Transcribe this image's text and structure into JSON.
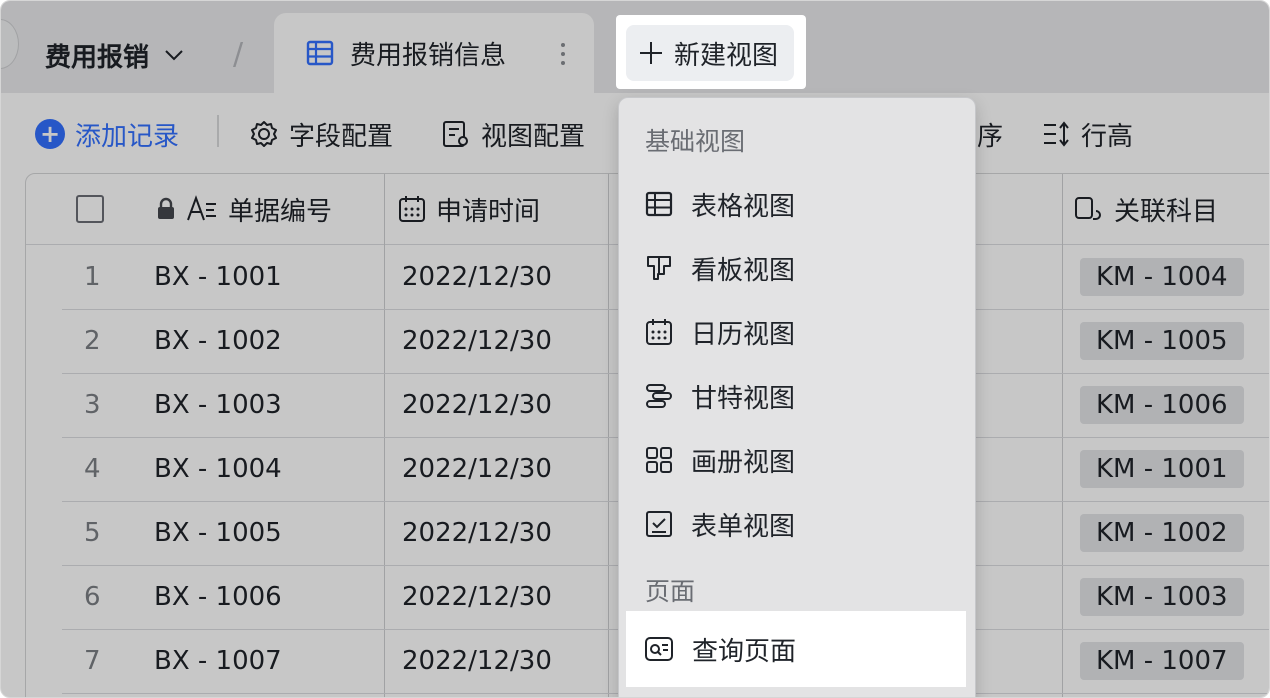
{
  "tabs": {
    "base_name": "费用报销",
    "separator": "/",
    "active_tab": "费用报销信息",
    "new_view": "新建视图"
  },
  "toolbar": {
    "add_record": "添加记录",
    "field_config": "字段配置",
    "view_config": "视图配置",
    "sort_partial": "序",
    "row_height": "行高"
  },
  "table": {
    "columns": [
      "单据编号",
      "申请时间",
      "关联科目"
    ],
    "rows": [
      {
        "n": "1",
        "id": "BX - 1001",
        "date": "2022/12/30",
        "subject": "KM - 1004"
      },
      {
        "n": "2",
        "id": "BX - 1002",
        "date": "2022/12/30",
        "subject": "KM - 1005"
      },
      {
        "n": "3",
        "id": "BX - 1003",
        "date": "2022/12/30",
        "subject": "KM - 1006"
      },
      {
        "n": "4",
        "id": "BX - 1004",
        "date": "2022/12/30",
        "subject": "KM - 1001"
      },
      {
        "n": "5",
        "id": "BX - 1005",
        "date": "2022/12/30",
        "subject": "KM - 1002"
      },
      {
        "n": "6",
        "id": "BX - 1006",
        "date": "2022/12/30",
        "subject": "KM - 1003"
      },
      {
        "n": "7",
        "id": "BX - 1007",
        "date": "2022/12/30",
        "subject": "KM - 1007"
      }
    ]
  },
  "menu": {
    "group_basic": "基础视图",
    "items": [
      "表格视图",
      "看板视图",
      "日历视图",
      "甘特视图",
      "画册视图",
      "表单视图"
    ],
    "group_page": "页面",
    "query_page": "查询页面"
  },
  "colors": {
    "accent": "#3370ff",
    "overlay": "rgba(0,0,0,0.22)"
  }
}
